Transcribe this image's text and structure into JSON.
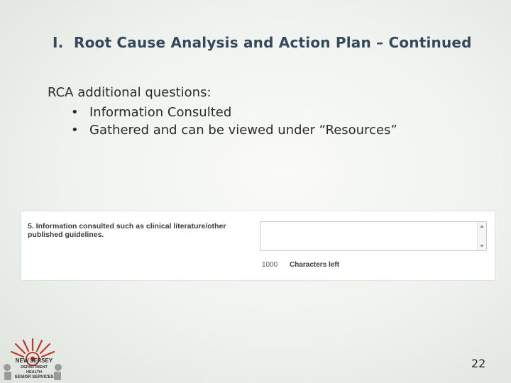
{
  "slide": {
    "title_number": "I.",
    "title_text": "Root Cause Analysis and Action Plan – Continued",
    "intro": "RCA additional questions:",
    "bullets": [
      "Information Consulted",
      "Gathered and can be viewed under “Resources”"
    ],
    "bullet_glyph": "•",
    "page_number": "22"
  },
  "form": {
    "question_line1": "5. Information consulted such as clinical literature/other",
    "question_line2": "published guidelines.",
    "textarea_value": "",
    "char_count": "1000",
    "char_label": "Characters left"
  },
  "logo": {
    "line1": "NEW JERSEY",
    "line2": "DEPARTMENT",
    "line3": "HEALTH",
    "line4": "SENIOR SERVICES",
    "icon": "nj-state-seal-icon",
    "color": "#c0392b"
  },
  "colors": {
    "title": "#34495c",
    "text": "#2a2a2a",
    "logo_accent": "#c0392b"
  }
}
